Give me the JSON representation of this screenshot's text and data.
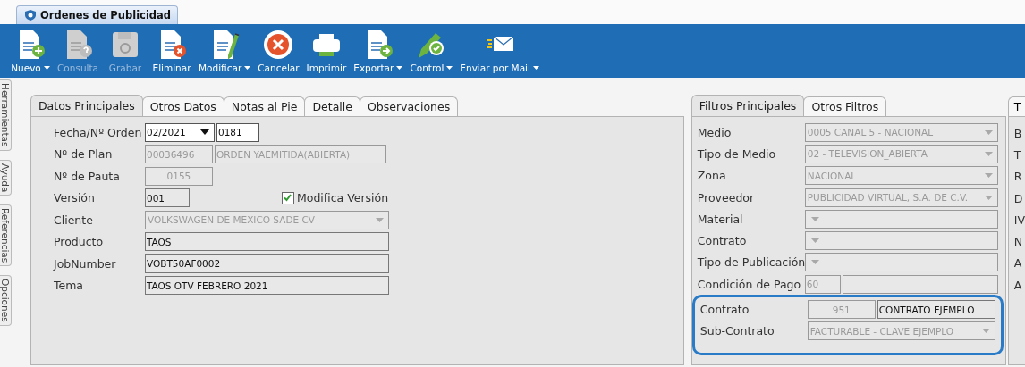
{
  "window": {
    "tab": "Ordenes de Publicidad"
  },
  "toolbar": [
    {
      "kind": "new",
      "label": "Nuevo",
      "menu": true,
      "disabled": false
    },
    {
      "kind": "query",
      "label": "Consulta",
      "menu": false,
      "disabled": true
    },
    {
      "kind": "save",
      "label": "Grabar",
      "menu": false,
      "disabled": true
    },
    {
      "kind": "delete",
      "label": "Eliminar",
      "menu": false,
      "disabled": false
    },
    {
      "kind": "edit",
      "label": "Modificar",
      "menu": true,
      "disabled": false
    },
    {
      "kind": "cancel",
      "label": "Cancelar",
      "menu": false,
      "disabled": false
    },
    {
      "kind": "print",
      "label": "Imprimir",
      "menu": false,
      "disabled": false
    },
    {
      "kind": "export",
      "label": "Exportar",
      "menu": true,
      "disabled": false
    },
    {
      "kind": "control",
      "label": "Control",
      "menu": true,
      "disabled": false
    },
    {
      "kind": "mail",
      "label": "Enviar por Mail",
      "menu": true,
      "disabled": false
    }
  ],
  "side_tabs": [
    "Herramientas",
    "Ayuda",
    "Referencias",
    "Opciones"
  ],
  "main_tabs": [
    {
      "label": "Datos Principales",
      "selected": true
    },
    {
      "label": "Otros Datos",
      "selected": false
    },
    {
      "label": "Notas al Pie",
      "selected": false
    },
    {
      "label": "Detalle",
      "selected": false
    },
    {
      "label": "Observaciones",
      "selected": false
    }
  ],
  "main_fields": [
    {
      "label": "Fecha/Nº Orden",
      "boxes": [
        {
          "kind": "combo",
          "value": "02/2021",
          "disabled": false
        },
        {
          "kind": "number",
          "value": "0181",
          "disabled": false
        }
      ]
    },
    {
      "label": "Nº de Plan",
      "boxes": [
        {
          "kind": "code",
          "value": "00036496",
          "disabled": true
        },
        {
          "kind": "status",
          "value": "ORDEN YAEMITIDA(ABIERTA)",
          "disabled": true
        }
      ]
    },
    {
      "label": "Nº de Pauta",
      "boxes": [
        {
          "kind": "code_center",
          "value": "0155",
          "disabled": true
        }
      ]
    },
    {
      "label": "Versión",
      "boxes": [
        {
          "kind": "short",
          "value": "001",
          "disabled": false
        }
      ],
      "checkbox": {
        "label": "Modifica Versión",
        "checked": true
      }
    },
    {
      "label": "Cliente",
      "boxes": [
        {
          "kind": "select",
          "value": "VOLKSWAGEN DE MEXICO SADE CV",
          "disabled": true
        }
      ]
    },
    {
      "label": "Producto",
      "boxes": [
        {
          "kind": "text",
          "value": "TAOS",
          "disabled": false
        }
      ]
    },
    {
      "label": "JobNumber",
      "boxes": [
        {
          "kind": "text",
          "value": "VOBT50AF0002",
          "disabled": false
        }
      ]
    },
    {
      "label": "Tema",
      "boxes": [
        {
          "kind": "text",
          "value": "TAOS OTV FEBRERO 2021",
          "disabled": false
        }
      ]
    }
  ],
  "filter_tabs": [
    {
      "label": "Filtros Principales",
      "selected": true
    },
    {
      "label": "Otros Filtros",
      "selected": false
    }
  ],
  "filter_fields": [
    {
      "label": "Medio",
      "highlighted": false,
      "boxes": [
        {
          "kind": "select",
          "value": "0005 CANAL 5 - NACIONAL",
          "disabled": true
        }
      ]
    },
    {
      "label": "Tipo de Medio",
      "highlighted": false,
      "boxes": [
        {
          "kind": "select",
          "value": "02 - TELEVISION_ABIERTA",
          "disabled": true
        }
      ]
    },
    {
      "label": "Zona",
      "highlighted": false,
      "boxes": [
        {
          "kind": "select",
          "value": "NACIONAL",
          "disabled": true
        }
      ]
    },
    {
      "label": "Proveedor",
      "highlighted": false,
      "boxes": [
        {
          "kind": "select",
          "value": "PUBLICIDAD VIRTUAL, S.A. DE C.V.",
          "disabled": true
        }
      ]
    },
    {
      "label": "Material",
      "highlighted": false,
      "boxes": [
        {
          "kind": "select",
          "disabled": true
        }
      ]
    },
    {
      "label": "Contrato",
      "highlighted": false,
      "boxes": [
        {
          "kind": "select",
          "disabled": true
        }
      ]
    },
    {
      "label": "Tipo de Publicación",
      "highlighted": false,
      "boxes": [
        {
          "kind": "select",
          "disabled": true
        }
      ]
    },
    {
      "label": "Condición de Pago",
      "highlighted": false,
      "boxes": [
        {
          "kind": "tiny",
          "value": "60",
          "disabled": true
        },
        {
          "kind": "text",
          "disabled": true
        }
      ]
    },
    {
      "label": "Contrato",
      "highlighted": true,
      "boxes": [
        {
          "kind": "code_center",
          "value": "951",
          "disabled": true
        },
        {
          "kind": "text",
          "value": "CONTRATO EJEMPLO",
          "disabled": false
        }
      ]
    },
    {
      "label": "Sub-Contrato",
      "highlighted": true,
      "boxes": [
        {
          "kind": "select",
          "value": "FACTURABLE - CLAVE EJEMPLO",
          "disabled": true
        }
      ]
    }
  ],
  "third_panel": {
    "tab": "T",
    "labels": [
      "B",
      "T",
      "R",
      "D",
      "IV",
      "N",
      "A",
      "A"
    ]
  }
}
